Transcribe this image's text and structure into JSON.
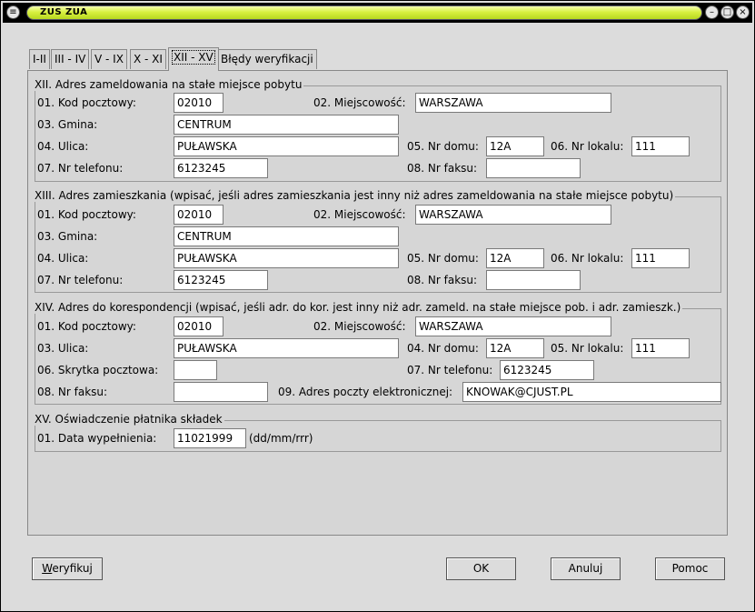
{
  "window": {
    "title": "ZUS ZUA"
  },
  "tabs": [
    {
      "label": "I-II",
      "active": false
    },
    {
      "label": "III - IV",
      "active": false
    },
    {
      "label": "V - IX",
      "active": false
    },
    {
      "label": "X - XI",
      "active": false
    },
    {
      "label": "XII - XV",
      "active": true
    },
    {
      "label": "Błędy weryfikacji",
      "active": false
    }
  ],
  "section_xii": {
    "title": "XII. Adres zameldowania na stałe miejsce pobytu",
    "kod_label": "01. Kod pocztowy:",
    "kod": "02010",
    "miejsc_label": "02. Miejscowość:",
    "miejsc": "WARSZAWA",
    "gmina_label": "03. Gmina:",
    "gmina": "CENTRUM",
    "ulica_label": "04. Ulica:",
    "ulica": "PUŁAWSKA",
    "domu_label": "05. Nr domu:",
    "domu": "12A",
    "lokalu_label": "06. Nr lokalu:",
    "lokalu": "111",
    "tel_label": "07. Nr telefonu:",
    "tel": "6123245",
    "fax_label": "08. Nr faksu:",
    "fax": ""
  },
  "section_xiii": {
    "title": "XIII. Adres zamieszkania (wpisać, jeśli adres zamieszkania jest inny niż adres zameldowania na stałe miejsce pobytu)",
    "kod_label": "01. Kod pocztowy:",
    "kod": "02010",
    "miejsc_label": "02. Miejscowość:",
    "miejsc": "WARSZAWA",
    "gmina_label": "03. Gmina:",
    "gmina": "CENTRUM",
    "ulica_label": "04. Ulica:",
    "ulica": "PUŁAWSKA",
    "domu_label": "05. Nr domu:",
    "domu": "12A",
    "lokalu_label": "06. Nr lokalu:",
    "lokalu": "111",
    "tel_label": "07. Nr telefonu:",
    "tel": "6123245",
    "fax_label": "08. Nr faksu:",
    "fax": ""
  },
  "section_xiv": {
    "title": "XIV. Adres do korespondencji (wpisać, jeśli adr. do kor. jest inny niż adr. zameld. na stałe miejsce pob. i adr. zamieszk.)",
    "kod_label": "01. Kod pocztowy:",
    "kod": "02010",
    "miejsc_label": "02. Miejscowość:",
    "miejsc": "WARSZAWA",
    "ulica_label": "03. Ulica:",
    "ulica": "PUŁAWSKA",
    "domu_label": "04. Nr domu:",
    "domu": "12A",
    "lokalu_label": "05. Nr lokalu:",
    "lokalu": "111",
    "skrytka_label": "06. Skrytka pocztowa:",
    "skrytka": "",
    "tel_label": "07. Nr telefonu:",
    "tel": "6123245",
    "fax_label": "08. Nr faksu:",
    "fax": "",
    "email_label": "09. Adres poczty elektronicznej:",
    "email": "KNOWAK@CJUST.PL"
  },
  "section_xv": {
    "title": "XV. Oświadczenie płatnika składek",
    "data_label": "01. Data wypełnienia:",
    "data": "11021999",
    "format_hint": "(dd/mm/rrr)"
  },
  "buttons": {
    "weryfikuj_mnemonic": "W",
    "weryfikuj_rest": "eryfikuj",
    "ok": "OK",
    "anuluj": "Anuluj",
    "pomoc": "Pomoc"
  }
}
